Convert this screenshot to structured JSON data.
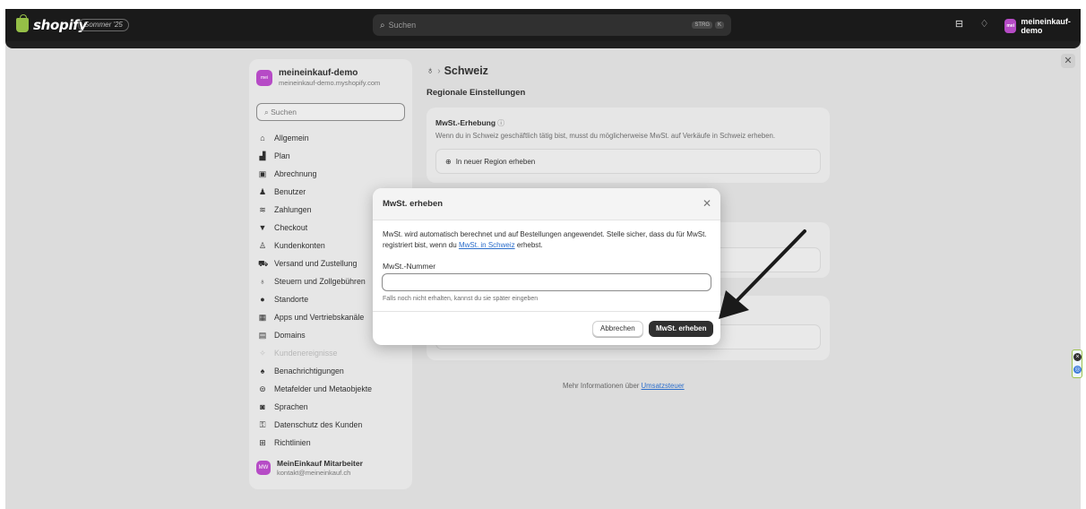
{
  "topbar": {
    "logo_text": "shopify",
    "edition": "Sommer '25",
    "search_placeholder": "Suchen",
    "kbd_1": "STRG",
    "kbd_2": "K",
    "store_name": "meineinkauf-demo",
    "store_avatar": "mei"
  },
  "sidebar": {
    "store_avatar": "mei",
    "store_name": "meineinkauf-demo",
    "store_domain": "meineinkauf-demo.myshopify.com",
    "search_placeholder": "Suchen",
    "items": [
      {
        "label": "Allgemein",
        "icon": "store-icon"
      },
      {
        "label": "Plan",
        "icon": "plan-icon"
      },
      {
        "label": "Abrechnung",
        "icon": "billing-icon"
      },
      {
        "label": "Benutzer",
        "icon": "users-icon"
      },
      {
        "label": "Zahlungen",
        "icon": "payments-icon"
      },
      {
        "label": "Checkout",
        "icon": "cart-icon"
      },
      {
        "label": "Kundenkonten",
        "icon": "person-icon"
      },
      {
        "label": "Versand und Zustellung",
        "icon": "truck-icon"
      },
      {
        "label": "Steuern und Zollgebühren",
        "icon": "taxes-icon"
      },
      {
        "label": "Standorte",
        "icon": "location-icon"
      },
      {
        "label": "Apps und Vertriebskanäle",
        "icon": "apps-icon"
      },
      {
        "label": "Domains",
        "icon": "globe-icon"
      },
      {
        "label": "Kundenereignisse",
        "icon": "events-icon"
      },
      {
        "label": "Benachrichtigungen",
        "icon": "bell-icon"
      },
      {
        "label": "Metafelder und Metaobjekte",
        "icon": "metafields-icon"
      },
      {
        "label": "Sprachen",
        "icon": "language-icon"
      },
      {
        "label": "Datenschutz des Kunden",
        "icon": "lock-icon"
      },
      {
        "label": "Richtlinien",
        "icon": "policy-icon"
      }
    ],
    "footer_avatar": "MW",
    "footer_name": "MeinEinkauf Mitarbeiter",
    "footer_email": "kontakt@meineinkauf.ch"
  },
  "main": {
    "page_title": "Schweiz",
    "section_title": "Regionale Einstellungen",
    "card_title": "MwSt.-Erhebung",
    "card_desc": "Wenn du in Schweiz geschäftlich tätig bist, musst du möglicherweise MwSt. auf Verkäufe in Schweiz erheben.",
    "new_region_label": "In neuer Region erheben",
    "more_info_prefix": "Mehr Informationen über ",
    "more_info_link": "Umsatzsteuer"
  },
  "modal": {
    "title": "MwSt. erheben",
    "text_before": "MwSt. wird automatisch berechnet und auf Bestellungen angewendet. Stelle sicher, dass du für MwSt. registriert bist, wenn du ",
    "text_link": "MwSt. in Schweiz",
    "text_after": " erhebst.",
    "field_label": "MwSt.-Nummer",
    "field_value": "",
    "field_help": "Falls noch nicht erhalten, kannst du sie später eingeben",
    "cancel_label": "Abbrechen",
    "confirm_label": "MwSt. erheben"
  },
  "colors": {
    "topbar": "#1a1a1a",
    "backdrop": "#dcdcdc",
    "primary_button": "#303030",
    "link": "#2c6ecb",
    "avatar": "#b64bc6"
  }
}
